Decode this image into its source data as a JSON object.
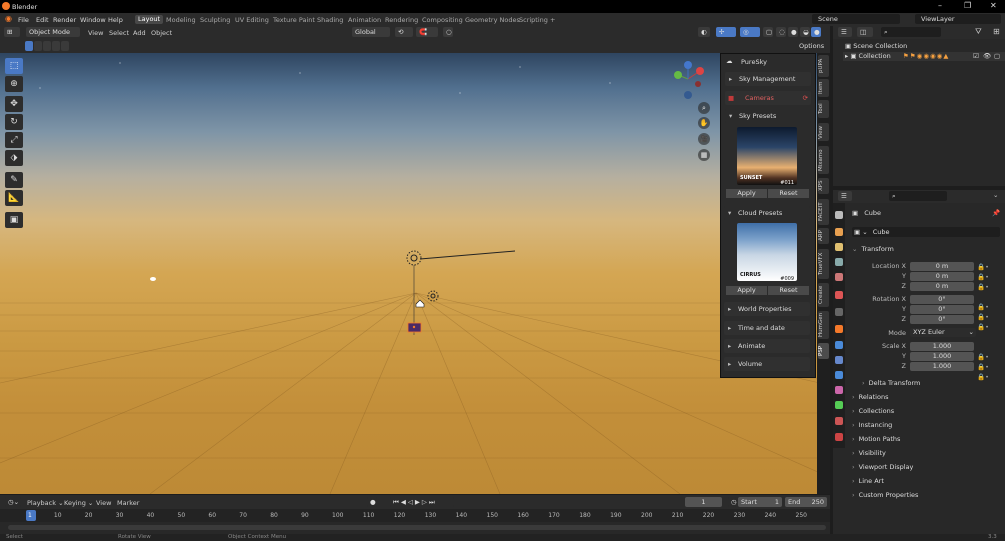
{
  "app": {
    "title": "Blender"
  },
  "top_menu": [
    "File",
    "Edit",
    "Render",
    "Window",
    "Help"
  ],
  "workspaces": [
    {
      "label": "Layout",
      "active": true
    },
    {
      "label": "Modeling"
    },
    {
      "label": "Sculpting"
    },
    {
      "label": "UV Editing"
    },
    {
      "label": "Texture Paint"
    },
    {
      "label": "Shading"
    },
    {
      "label": "Animation"
    },
    {
      "label": "Rendering"
    },
    {
      "label": "Compositing"
    },
    {
      "label": "Geometry Nodes"
    },
    {
      "label": "Scripting"
    }
  ],
  "add_workspace": "+",
  "scene": "Scene",
  "view_layer": "ViewLayer",
  "viewport_header": {
    "mode": "Object Mode",
    "menus": [
      "View",
      "Select",
      "Add",
      "Object"
    ],
    "orientation": "Global",
    "options": "Options"
  },
  "pure_sky": {
    "title": "PureSky",
    "sky_management": "Sky Management",
    "cameras": "Cameras",
    "sky_presets": "Sky Presets",
    "sky_thumb_name": "SUNSET",
    "sky_thumb_code": "#011",
    "apply": "Apply",
    "reset": "Reset",
    "cloud_presets": "Cloud Presets",
    "cloud_thumb_name": "CIRRUS",
    "cloud_thumb_code": "#009",
    "world_properties": "World Properties",
    "time_and_date": "Time and date",
    "animate": "Animate",
    "volume": "Volume"
  },
  "side_tabs": [
    "pUPA",
    "Item",
    "Tool",
    "View",
    "Mixamo",
    "XPS",
    "FACEIT",
    "ARP",
    "TrueVFX",
    "Create",
    "HumGen",
    "PSP"
  ],
  "outliner": {
    "scene_collection": "Scene Collection",
    "collection": "Collection"
  },
  "properties": {
    "object_name": "Cube",
    "data_name": "Cube",
    "transform": "Transform",
    "location_label": "Location X",
    "loc": [
      "0 m",
      "0 m",
      "0 m"
    ],
    "rotation_label": "Rotation X",
    "rot": [
      "0°",
      "0°",
      "0°"
    ],
    "mode_label": "Mode",
    "mode": "XYZ Euler",
    "scale_label": "Scale X",
    "scale": [
      "1.000",
      "1.000",
      "1.000"
    ],
    "y": "Y",
    "z": "Z",
    "sections": [
      "Relations",
      "Collections",
      "Instancing",
      "Motion Paths",
      "Visibility",
      "Viewport Display",
      "Line Art",
      "Custom Properties"
    ],
    "delta": "Delta Transform"
  },
  "timeline": {
    "menus": [
      "Playback",
      "Keying",
      "View",
      "Marker"
    ],
    "current_frame": "1",
    "start_label": "Start",
    "start": "1",
    "end_label": "End",
    "end": "250",
    "ticks": [
      "1",
      "10",
      "20",
      "30",
      "40",
      "50",
      "60",
      "70",
      "80",
      "90",
      "100",
      "110",
      "120",
      "130",
      "140",
      "150",
      "160",
      "170",
      "180",
      "190",
      "200",
      "210",
      "220",
      "230",
      "240",
      "250"
    ]
  },
  "status_bar": {
    "select": "Select",
    "rotate": "Rotate View",
    "context": "Object Context Menu",
    "version": "3.3"
  },
  "colors": {
    "accent": "#4a79c5",
    "header": "#2b2b2b",
    "panel": "#282828",
    "camera_red": "#c03a3a"
  }
}
